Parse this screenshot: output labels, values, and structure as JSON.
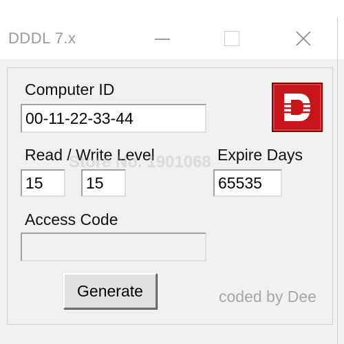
{
  "window": {
    "title": "DDDL 7.x"
  },
  "fields": {
    "computer_id": {
      "label": "Computer ID",
      "value": "00-11-22-33-44"
    },
    "read_write": {
      "label": "Read / Write Level",
      "read_value": "15",
      "write_value": "15"
    },
    "expire_days": {
      "label": "Expire Days",
      "value": "65535"
    },
    "access_code": {
      "label": "Access Code",
      "value": ""
    }
  },
  "buttons": {
    "generate": "Generate"
  },
  "footer": {
    "credit": "coded by Dee"
  },
  "watermark": "Store No. 1901068",
  "logo": {
    "color": "#c5151b",
    "stripe_color": "#ffffff"
  }
}
